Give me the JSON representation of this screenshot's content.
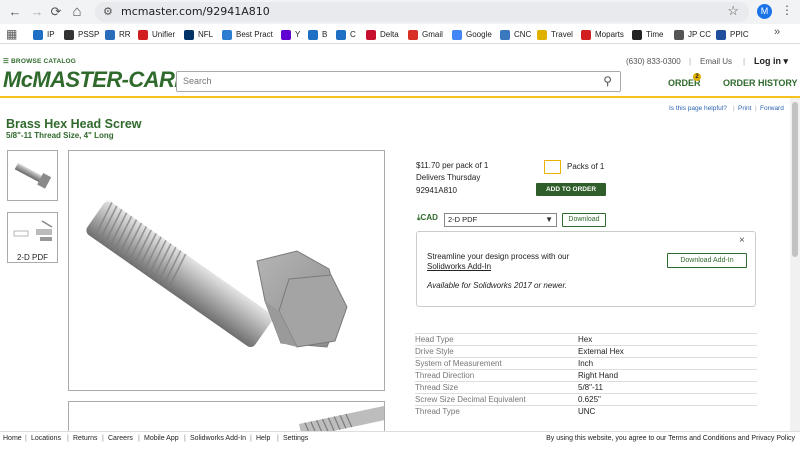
{
  "browser": {
    "url": "mcmaster.com/92941A810",
    "profile_initial": "M",
    "back": "←",
    "forward": "→",
    "reload": "⟳",
    "home": "⌂",
    "bookmarks": [
      {
        "label": "IP",
        "color": "#1f6fc5"
      },
      {
        "label": "PSSP",
        "color": "#333333"
      },
      {
        "label": "RR",
        "color": "#2a6ebb"
      },
      {
        "label": "Unifier",
        "color": "#d22020"
      },
      {
        "label": "NFL",
        "color": "#013369"
      },
      {
        "label": "Best Pract",
        "color": "#2a7dd1"
      },
      {
        "label": "Y",
        "color": "#6001d2"
      },
      {
        "label": "B",
        "color": "#1f6fc5"
      },
      {
        "label": "C",
        "color": "#1f6fc5"
      },
      {
        "label": "Delta",
        "color": "#c8102e"
      },
      {
        "label": "Gmail",
        "color": "#d93025"
      },
      {
        "label": "Google",
        "color": "#4285f4"
      },
      {
        "label": "CNC",
        "color": "#3a78c0"
      },
      {
        "label": "Travel",
        "color": "#e0b000"
      },
      {
        "label": "Moparts",
        "color": "#d22020"
      },
      {
        "label": "Time",
        "color": "#222222"
      },
      {
        "label": "JP CC",
        "color": "#555555"
      },
      {
        "label": "PPIC",
        "color": "#1f4e9c"
      }
    ]
  },
  "header": {
    "browse_catalog": "☰ BROWSE CATALOG",
    "logo": "McMASTER-CARR.",
    "search_placeholder": "Search",
    "phone": "(630) 833-0300",
    "email_us": "Email Us",
    "login": "Log in ▾",
    "order": "ORDER",
    "order_count": "2",
    "order_history": "ORDER HISTORY",
    "brand_color": "#2f6a2c"
  },
  "utility": {
    "helpful": "Is this page helpful?",
    "print": "Print",
    "forward": "Forward"
  },
  "product": {
    "title": "Brass Hex Head Screw",
    "subtitle": "5/8\"-11 Thread Size, 4\" Long",
    "thumb2_label": "2-D PDF",
    "price": "$11.70 per pack of 1",
    "delivers": "Delivers Thursday",
    "part_number": "92941A810",
    "qty_value": "",
    "packs_label": "Packs of 1",
    "add_to_order": "ADD TO ORDER",
    "cad_label": "CAD",
    "cad_selected": "2-D PDF",
    "download": "Download"
  },
  "promo": {
    "line1": "Streamline your design process with our",
    "link": "Solidworks Add-In",
    "availability": "Available for Solidworks 2017 or newer.",
    "button": "Download Add-In",
    "close": "×"
  },
  "specs": [
    {
      "key": "Head Type",
      "value": "Hex"
    },
    {
      "key": "Drive Style",
      "value": "External Hex"
    },
    {
      "key": "System of Measurement",
      "value": "Inch"
    },
    {
      "key": "Thread Direction",
      "value": "Right Hand"
    },
    {
      "key": "Thread Size",
      "value": "5/8\"-11"
    },
    {
      "key": "Screw Size Decimal Equivalent",
      "value": "0.625\""
    },
    {
      "key": "Thread Type",
      "value": "UNC"
    }
  ],
  "footer": {
    "links": [
      "Home",
      "Locations",
      "Returns",
      "Careers",
      "Mobile App",
      "Solidworks Add-In",
      "Help",
      "Settings"
    ],
    "consent": "By using this website, you agree to our Terms and Conditions and Privacy Policy"
  }
}
